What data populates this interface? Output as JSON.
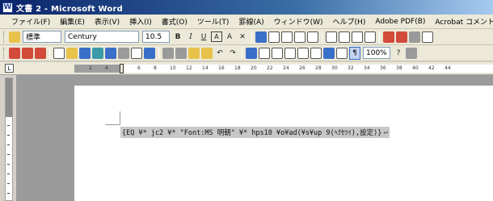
{
  "window": {
    "title": "文書 2 - Microsoft Word",
    "icon": "word-doc-icon"
  },
  "menu": [
    "ファイル(F)",
    "編集(E)",
    "表示(V)",
    "挿入(I)",
    "書式(O)",
    "ツール(T)",
    "罫線(A)",
    "ウィンドウ(W)",
    "ヘルプ(H)",
    "Adobe PDF(B)",
    "Acrobat コメント(C)"
  ],
  "format_toolbar": {
    "style": "標準",
    "font": "Century",
    "size": "10.5",
    "bold": "B",
    "italic": "I",
    "underline": "U",
    "char_border": "A",
    "char_shade": "A"
  },
  "standard_toolbar": {
    "zoom": "100%"
  },
  "ruler": {
    "ticks": [
      "2",
      "4",
      "6",
      "8",
      "10",
      "12",
      "14",
      "16",
      "18",
      "20",
      "22",
      "24",
      "26",
      "28",
      "30",
      "32",
      "34",
      "36",
      "38",
      "40",
      "42",
      "44"
    ]
  },
  "document": {
    "field_code": "{EQ ¥* jc2 ¥* \"Font:MS 明朝\" ¥* hps10 ¥o¥ad(¥s¥up 9(ﾍｸｾﾂｲ),設定)}",
    "paragraph_mark": "↵"
  },
  "colors": {
    "title_bar": "#0a246a",
    "chrome": "#ece9d8",
    "workspace": "#9b9b9b",
    "field_shade": "#c8c8c8"
  }
}
